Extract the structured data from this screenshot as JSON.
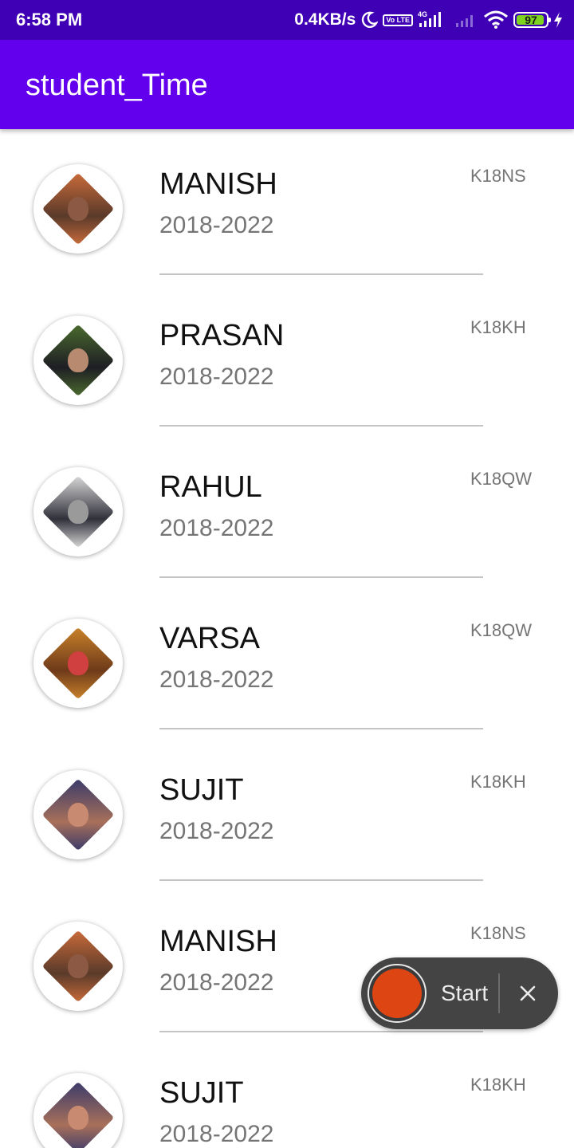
{
  "status_bar": {
    "time": "6:58 PM",
    "net_speed": "0.4KB/s",
    "icons": [
      "moon-icon",
      "volte-icon",
      "signal-4g-icon",
      "signal-empty-icon",
      "wifi-icon",
      "battery-icon",
      "charging-icon"
    ],
    "volte_label": "Vo LTE",
    "network_type": "4G",
    "battery_level": "97"
  },
  "app_bar": {
    "title": "student_Time",
    "color": "#6200ee"
  },
  "students": [
    {
      "name": "MANISH",
      "years": "2018-2022",
      "section": "K18NS",
      "avatar_colors": [
        "#c96b3a",
        "#5a3a2a",
        "#8c5a44"
      ]
    },
    {
      "name": "PRASAN",
      "years": "2018-2022",
      "section": "K18KH",
      "avatar_colors": [
        "#4b6b2e",
        "#1e1e24",
        "#b88a70"
      ]
    },
    {
      "name": "RAHUL",
      "years": "2018-2022",
      "section": "K18QW",
      "avatar_colors": [
        "#d8d8d8",
        "#30303a",
        "#9a9a9a"
      ]
    },
    {
      "name": "VARSA",
      "years": "2018-2022",
      "section": "K18QW",
      "avatar_colors": [
        "#c9822a",
        "#6e3a1a",
        "#d04040"
      ]
    },
    {
      "name": "SUJIT",
      "years": "2018-2022",
      "section": "K18KH",
      "avatar_colors": [
        "#3a3a6a",
        "#a8705a",
        "#c88a70"
      ]
    },
    {
      "name": "MANISH",
      "years": "2018-2022",
      "section": "K18NS",
      "avatar_colors": [
        "#c96b3a",
        "#5a3a2a",
        "#8c5a44"
      ]
    },
    {
      "name": "SUJIT",
      "years": "2018-2022",
      "section": "K18KH",
      "avatar_colors": [
        "#3a3a6a",
        "#a8705a",
        "#c88a70"
      ]
    }
  ],
  "recorder": {
    "start_label": "Start",
    "record_color": "#dd4512"
  }
}
